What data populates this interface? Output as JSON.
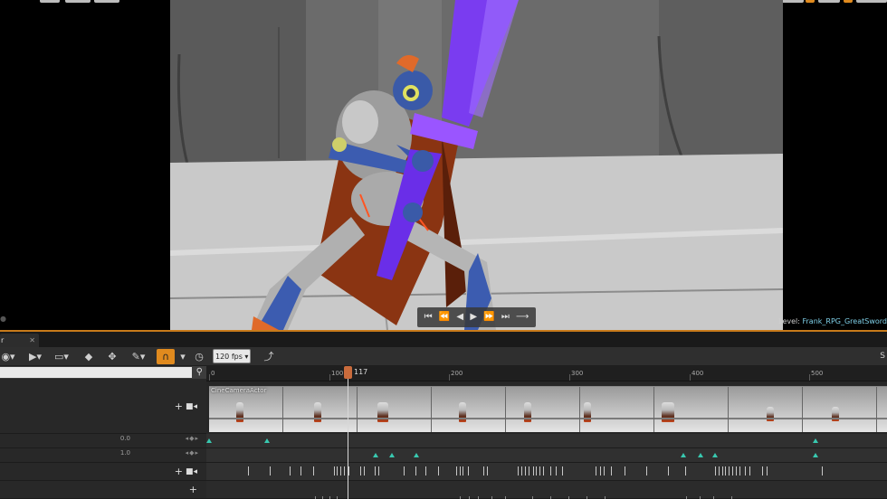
{
  "viewport": {
    "level_label": "Level:",
    "level_name": "Frank_RPG_GreatSword",
    "transport_controls": [
      "⏮",
      "⏪",
      "◀",
      "▶",
      "⏩",
      "⏭",
      "⟶"
    ]
  },
  "sequencer": {
    "tab_label": "r",
    "tab_close": "✕",
    "toolbar": {
      "fps_value": "120 fps",
      "right_text": "S",
      "colors": {
        "snap_active": "#e08a1e"
      }
    },
    "search": {
      "placeholder": ""
    },
    "rows": [
      {
        "name": "camera-actor-row",
        "value": ""
      },
      {
        "name": "property-row-1",
        "value": "0.0"
      },
      {
        "name": "property-row-2",
        "value": "1.0"
      },
      {
        "name": "track-row-3",
        "value": ""
      },
      {
        "name": "track-row-4",
        "value": ""
      }
    ],
    "ruler": {
      "labels": [
        "0",
        "100",
        "200",
        "300",
        "400",
        "500"
      ],
      "playhead_frame": "117"
    },
    "camera_track_label": "CineCameraActor",
    "colors": {
      "key": "#38c9b0",
      "playhead": "#c96b3c",
      "accent": "#c77a1a"
    }
  }
}
